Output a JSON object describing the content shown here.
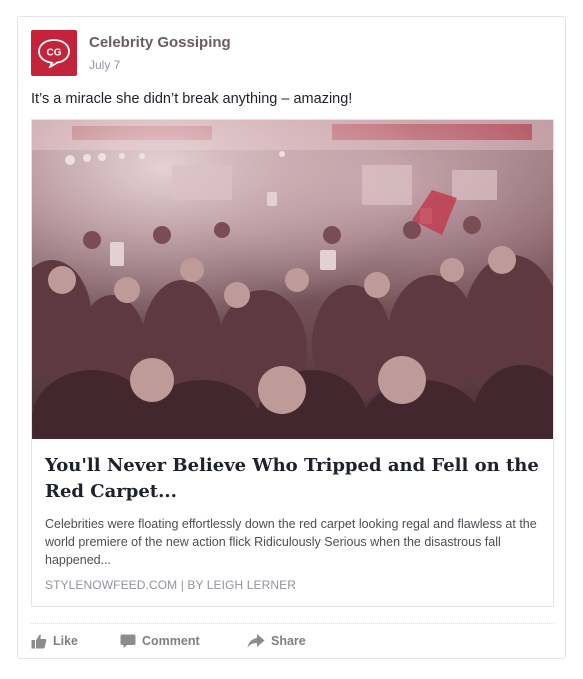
{
  "post": {
    "page_name": "Celebrity Gossiping",
    "logo_text": "CG",
    "date": "July 7",
    "status_text": "It’s a miracle she didn’t break anything – amazing!",
    "brand_color": "#c3243c"
  },
  "link": {
    "image_icon": "crowd-photo",
    "title": "You'll Never Believe Who Tripped and Fell on the Red Carpet...",
    "description": "Celebrities were floating effortlessly down the red carpet looking regal and flawless at the world premiere of the new action flick Ridiculously Serious when the disastrous fall happened...",
    "source": "STYLENOWFEED.COM | BY LEIGH LERNER"
  },
  "actions": {
    "like_label": "Like",
    "comment_label": "Comment",
    "share_label": "Share"
  }
}
